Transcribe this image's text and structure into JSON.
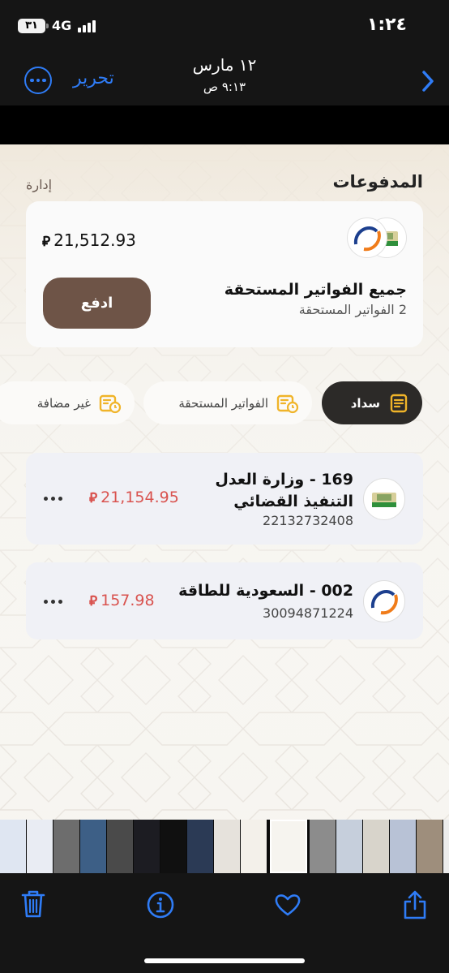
{
  "status_bar": {
    "time": "١:٢٤",
    "battery_level": "٣١",
    "network": "4G"
  },
  "photos_nav": {
    "title": "١٢ مارس",
    "subtitle": "٩:١٣ ص",
    "edit_label": "تحرير"
  },
  "payments": {
    "title": "المدفوعات",
    "manage_link": "إدارة",
    "summary": {
      "amount": "21,512.93",
      "title": "جميع الفواتير المستحقة",
      "subtitle": "2 الفواتير المستحقة",
      "pay_button": "ادفع"
    },
    "filters": [
      {
        "label": "سداد",
        "active": true
      },
      {
        "label": "الفواتير المستحقة",
        "active": false
      },
      {
        "label": "غير مضافة",
        "active": false
      }
    ],
    "bills": [
      {
        "title_line1": "169 - وزارة العدل",
        "title_line2": "التنفيذ القضائي",
        "number": "22132732408",
        "amount": "21,154.95"
      },
      {
        "title_line1": "002 - السعودية للطاقة",
        "number": "30094871224",
        "amount": "157.98"
      }
    ]
  },
  "colors": {
    "accent_blue": "#2f7cf6",
    "pay_button": "#6e5447",
    "active_chip": "#2c2a28",
    "amount_red": "#d9534f",
    "chip_icon_gold": "#f0b429"
  },
  "toolbar": {
    "icons": [
      "trash-icon",
      "info-icon",
      "heart-icon",
      "share-icon"
    ]
  }
}
